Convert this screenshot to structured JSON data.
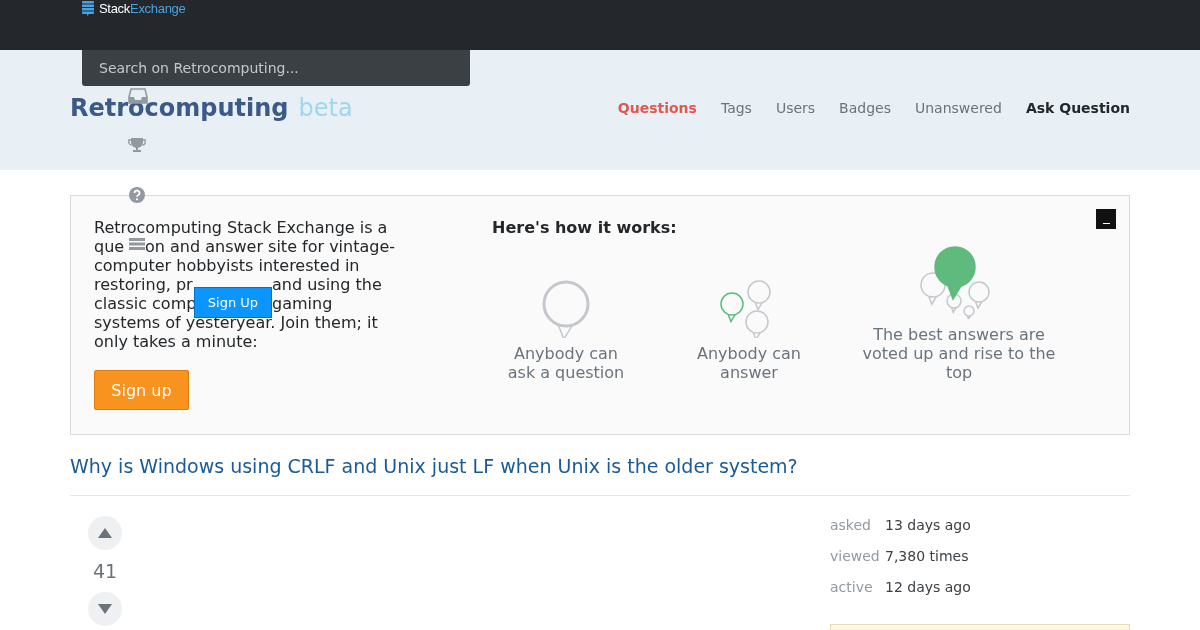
{
  "topbar": {
    "logo_first": "Stack",
    "logo_second": "Exchange"
  },
  "search": {
    "placeholder": "Search on Retrocomputing..."
  },
  "site": {
    "name": "Retrocomputing",
    "tag": "beta"
  },
  "nav": [
    {
      "label": "Questions",
      "selected": true
    },
    {
      "label": "Tags",
      "selected": false
    },
    {
      "label": "Users",
      "selected": false
    },
    {
      "label": "Badges",
      "selected": false
    },
    {
      "label": "Unanswered",
      "selected": false
    }
  ],
  "ask_question": "Ask Question",
  "signup_banner": {
    "lines": [
      {
        "kind": "whole",
        "fragments": [
          "Retrocomputing Stack Exchange is a"
        ]
      },
      {
        "kind": "icon_gap",
        "fragments": [
          "que",
          "on and answer site for vintage-"
        ]
      },
      {
        "kind": "whole",
        "fragments": [
          "computer hobbyists interested in"
        ]
      },
      {
        "kind": "button_gap",
        "fragments": [
          "restoring, pr",
          "and using the"
        ]
      },
      {
        "kind": "button_gap",
        "fragments": [
          "classic comp",
          "gaming"
        ]
      },
      {
        "kind": "whole",
        "fragments": [
          "systems of yesteryear. Join them; it"
        ]
      },
      {
        "kind": "whole",
        "fragments": [
          "only takes a minute:"
        ]
      }
    ],
    "button": "Sign up",
    "how_title": "Here's how it works:",
    "steps": [
      {
        "kind": "ask",
        "text": "Anybody can ask a question"
      },
      {
        "kind": "answer",
        "text": "Anybody can answer"
      },
      {
        "kind": "vote",
        "text": "The best answers are voted up and rise to the top"
      }
    ]
  },
  "overlay": {
    "button": "Sign Up"
  },
  "question": {
    "title": "Why is Windows using CRLF and Unix just LF when Unix is the older system?",
    "votes": "41",
    "meta": [
      {
        "label": "asked",
        "value": "13 days ago"
      },
      {
        "label": "viewed",
        "value": "7,380 times"
      },
      {
        "label": "active",
        "value": "12 days ago"
      }
    ]
  }
}
